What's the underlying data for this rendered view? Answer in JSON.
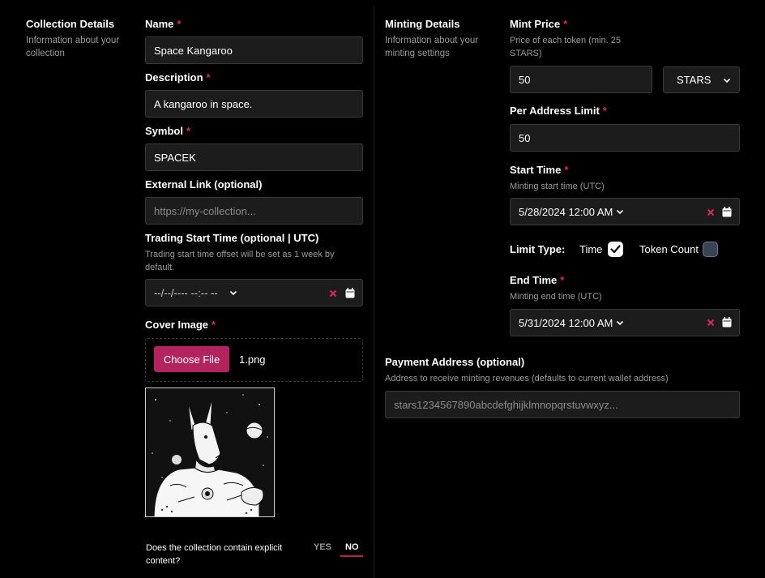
{
  "collection_details": {
    "title": "Collection Details",
    "description": "Information about your collection"
  },
  "name": {
    "label": "Name",
    "required": "*",
    "value": "Space Kangaroo"
  },
  "description": {
    "label": "Description",
    "required": "*",
    "value": "A kangaroo in space."
  },
  "symbol": {
    "label": "Symbol",
    "required": "*",
    "value": "SPACEK"
  },
  "external_link": {
    "label": "External Link (optional)",
    "placeholder": "https://my-collection..."
  },
  "trading_start": {
    "label": "Trading Start Time (optional | UTC)",
    "hint": "Trading start time offset will be set as 1 week by default.",
    "value": "--/--/---- --:--  --"
  },
  "cover_image": {
    "label": "Cover Image",
    "required": "*",
    "button_label": "Choose File",
    "file_name": "1.png"
  },
  "explicit": {
    "question": "Does the collection contain explicit content?",
    "yes_label": "YES",
    "no_label": "NO",
    "selected": "NO"
  },
  "minting_details": {
    "title": "Minting Details",
    "description": "Information about your minting settings"
  },
  "mint_price": {
    "label": "Mint Price",
    "required": "*",
    "hint": "Price of each token (min. 25 STARS)",
    "value": "50",
    "denom": "STARS"
  },
  "per_address_limit": {
    "label": "Per Address Limit",
    "required": "*",
    "value": "50"
  },
  "start_time": {
    "label": "Start Time",
    "required": "*",
    "hint": "Minting start time (UTC)",
    "value": "5/28/2024 12:00  AM"
  },
  "limit_type": {
    "label": "Limit Type:",
    "option_time": "Time",
    "option_token_count": "Token Count",
    "time_checked": true,
    "token_count_checked": false
  },
  "end_time": {
    "label": "End Time",
    "required": "*",
    "hint": "Minting end time (UTC)",
    "value": "5/31/2024 12:00  AM"
  },
  "payment_address": {
    "label": "Payment Address (optional)",
    "hint": "Address to receive minting revenues (defaults to current wallet address)",
    "placeholder": "stars1234567890abcdefghijklmnopqrstuvwxyz..."
  },
  "colors": {
    "accent": "#b3245f",
    "required": "#e0245e",
    "input_bg": "#1c1c1c",
    "input_border": "#3a3a3a"
  }
}
